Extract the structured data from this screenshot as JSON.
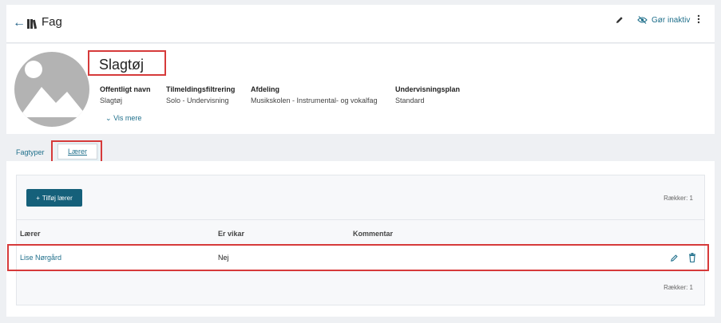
{
  "header": {
    "title": "Fag",
    "inactive_label": "Gør inaktiv"
  },
  "profile": {
    "name": "Slagtøj",
    "fields": [
      {
        "label": "Offentligt navn",
        "value": "Slagtøj"
      },
      {
        "label": "Tilmeldingsfiltrering",
        "value": "Solo - Undervisning"
      },
      {
        "label": "Afdeling",
        "value": "Musikskolen - Instrumental- og vokalfag"
      },
      {
        "label": "Undervisningsplan",
        "value": "Standard"
      }
    ],
    "more_label": "Vis mere"
  },
  "tabs": [
    {
      "label": "Fagtyper"
    },
    {
      "label": "Lærer"
    }
  ],
  "panel": {
    "add_button_label": "Tilføj lærer",
    "rows_count_label": "Rækker: 1",
    "columns": [
      "Lærer",
      "Er vikar",
      "Kommentar"
    ],
    "rows": [
      {
        "teacher": "Lise Nørgård",
        "substitute": "Nej",
        "comment": ""
      }
    ]
  },
  "colors": {
    "accent": "#15607a",
    "link": "#1f6f8b",
    "highlight": "#d63a3a"
  }
}
